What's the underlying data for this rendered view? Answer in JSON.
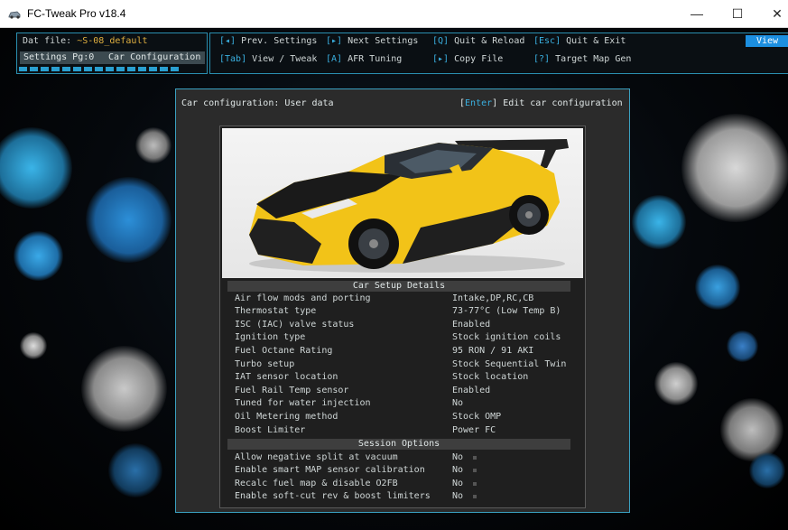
{
  "window": {
    "title": "FC-Tweak Pro v18.4",
    "controls": [
      "—",
      "☐",
      "✕"
    ]
  },
  "status": {
    "dat_label": "Dat file:",
    "dat_value": "~S-08_default",
    "settings_page": "Settings Pg:0",
    "section": "Car Configuration"
  },
  "menu": {
    "items": [
      {
        "key": "[◂]",
        "label": "Prev. Settings"
      },
      {
        "key": "[▸]",
        "label": "Next Settings"
      },
      {
        "key": "[Q]",
        "label": "Quit & Reload"
      },
      {
        "key": "[Esc]",
        "label": "Quit & Exit"
      },
      {
        "key": "[Tab]",
        "label": "View / Tweak"
      },
      {
        "key": "[A]",
        "label": "AFR Tuning"
      },
      {
        "key": "[▸]",
        "label": "Copy File"
      },
      {
        "key": "[?]",
        "label": "Target Map Gen"
      }
    ],
    "view_label": "View"
  },
  "dialog": {
    "title": "Car configuration: User data",
    "hint_key": "Enter",
    "hint_label": "Edit car configuration",
    "setup_heading": "Car Setup Details",
    "setup_rows": [
      {
        "label": "Air flow mods and porting",
        "value": "Intake,DP,RC,CB"
      },
      {
        "label": "Thermostat type",
        "value": "73-77°C (Low Temp B)"
      },
      {
        "label": "ISC (IAC) valve status",
        "value": "Enabled"
      },
      {
        "label": "Ignition type",
        "value": "Stock ignition coils"
      },
      {
        "label": "Fuel Octane Rating",
        "value": "95 RON / 91 AKI"
      },
      {
        "label": "Turbo setup",
        "value": "Stock Sequential Twin"
      },
      {
        "label": "IAT sensor location",
        "value": "Stock location"
      },
      {
        "label": "Fuel Rail Temp sensor",
        "value": "Enabled"
      },
      {
        "label": "Tuned for water injection",
        "value": "No"
      },
      {
        "label": "Oil Metering method",
        "value": "Stock OMP"
      },
      {
        "label": "Boost Limiter",
        "value": "Power FC"
      }
    ],
    "session_heading": "Session Options",
    "session_rows": [
      {
        "label": "Allow negative split at vacuum",
        "value": "No"
      },
      {
        "label": "Enable smart MAP sensor calibration",
        "value": "No"
      },
      {
        "label": "Recalc fuel map & disable O2FB",
        "value": "No"
      },
      {
        "label": "Enable soft-cut rev & boost limiters",
        "value": "No"
      }
    ]
  },
  "colors": {
    "accent": "#2a8fb0",
    "key_highlight": "#3ab0e0",
    "filename": "#e0b040",
    "view_button": "#1c8fe0",
    "dialog_bg": "#2b2b2b",
    "car_body": "#f2c318",
    "car_hood": "#1a1a1a"
  },
  "progress_fraction": 0.9
}
